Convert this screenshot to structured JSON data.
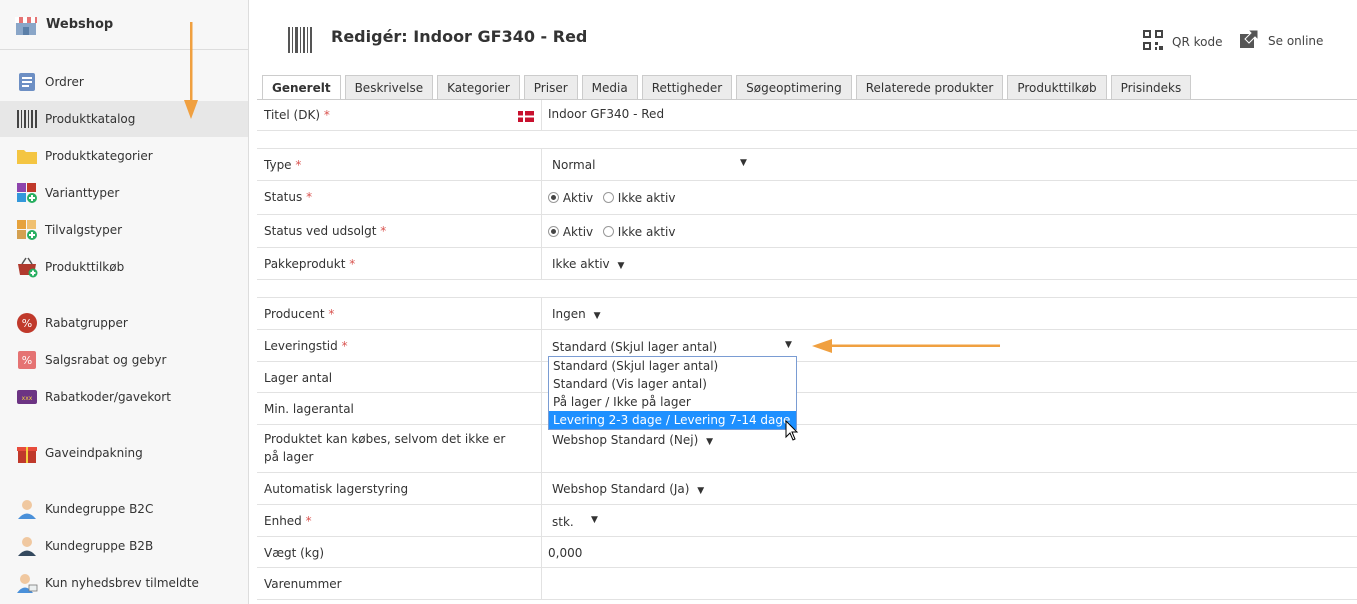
{
  "app": {
    "title": "Webshop"
  },
  "sidebar": {
    "items": [
      {
        "label": "Ordrer",
        "icon": "orders-icon"
      },
      {
        "label": "Produktkatalog",
        "icon": "barcode-icon",
        "active": true
      },
      {
        "label": "Produktkategorier",
        "icon": "folder-icon"
      },
      {
        "label": "Varianttyper",
        "icon": "variant-types-icon"
      },
      {
        "label": "Tilvalgstyper",
        "icon": "option-types-icon"
      },
      {
        "label": "Produkttilkøb",
        "icon": "basket-icon"
      },
      {
        "label": "Rabatgrupper",
        "icon": "discount-group-icon"
      },
      {
        "label": "Salgsrabat og gebyr",
        "icon": "percent-tag-icon"
      },
      {
        "label": "Rabatkoder/gavekort",
        "icon": "voucher-icon"
      },
      {
        "label": "Gaveindpakning",
        "icon": "gift-icon"
      },
      {
        "label": "Kundegruppe B2C",
        "icon": "user-icon"
      },
      {
        "label": "Kundegruppe B2B",
        "icon": "user-business-icon"
      },
      {
        "label": "Kun nyhedsbrev tilmeldte",
        "icon": "newsletter-user-icon"
      }
    ]
  },
  "header": {
    "title": "Redigér: Indoor GF340 - Red",
    "qr_label": "QR kode",
    "online_label": "Se online"
  },
  "tabs": [
    "Generelt",
    "Beskrivelse",
    "Kategorier",
    "Priser",
    "Media",
    "Rettigheder",
    "Søgeoptimering",
    "Relaterede produkter",
    "Produkttilkøb",
    "Prisindeks"
  ],
  "form": {
    "title_label": "Titel (DK)",
    "title_value": "Indoor GF340 - Red",
    "type_label": "Type",
    "type_value": "Normal",
    "status_label": "Status",
    "status_soldout_label": "Status ved udsolgt",
    "active_label": "Aktiv",
    "inactive_label": "Ikke aktiv",
    "package_label": "Pakkeprodukt",
    "package_value": "Ikke aktiv",
    "producer_label": "Producent",
    "producer_value": "Ingen",
    "delivery_label": "Leveringstid",
    "delivery_value": "Standard (Skjul lager antal)",
    "stock_label": "Lager antal",
    "min_stock_label": "Min. lagerantal",
    "buy_oos_label": "Produktet kan købes, selvom det ikke er på lager",
    "buy_oos_value": "Webshop Standard (Nej)",
    "auto_stock_label": "Automatisk lagerstyring",
    "auto_stock_value": "Webshop Standard (Ja)",
    "unit_label": "Enhed",
    "unit_value": "stk.",
    "weight_label": "Vægt (kg)",
    "weight_value": "0,000",
    "sku_label": "Varenummer",
    "required_mark": "*"
  },
  "delivery_options": [
    "Standard (Skjul lager antal)",
    "Standard (Vis lager antal)",
    "På lager / Ikke på lager",
    "Levering 2-3 dage / Levering 7-14 dage"
  ],
  "colors": {
    "accent_arrow": "#f0a040",
    "selected_option": "#1e90ff"
  }
}
